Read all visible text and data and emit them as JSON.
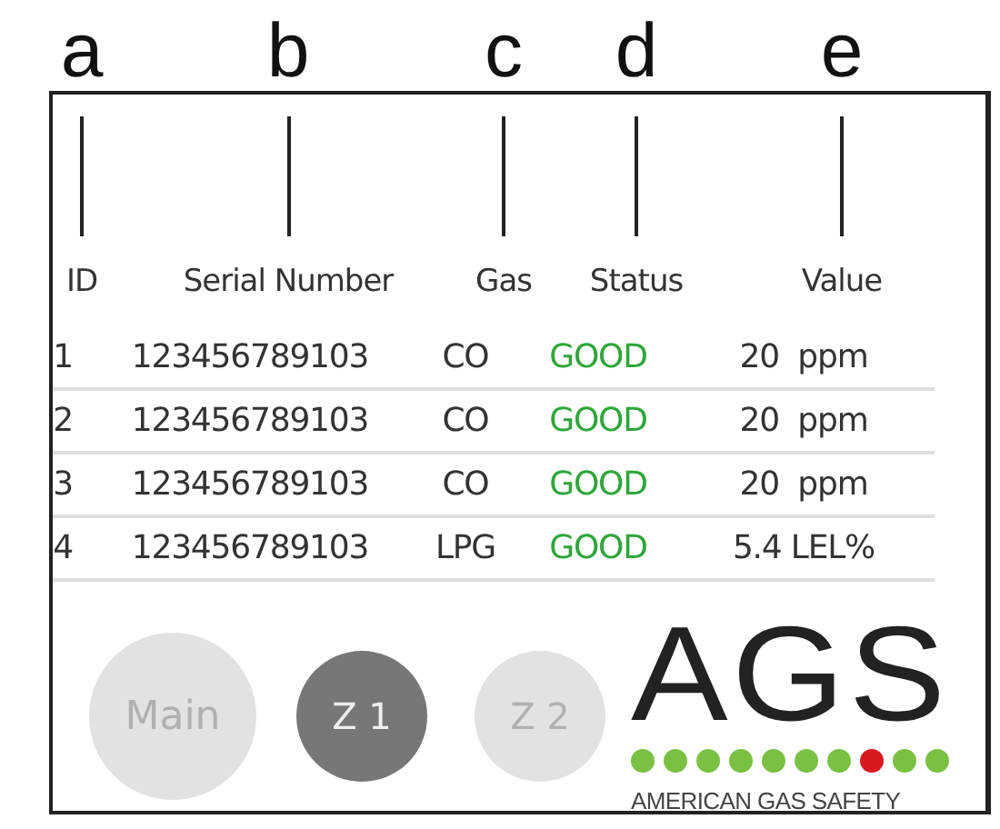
{
  "callouts": [
    "a",
    "b",
    "c",
    "d",
    "e"
  ],
  "columns": [
    "ID",
    "Serial Number",
    "Gas",
    "Status",
    "Value"
  ],
  "rows": [
    {
      "id": "1",
      "serial": "123456789103",
      "gas": "CO",
      "status": "GOOD",
      "value": "20  ppm"
    },
    {
      "id": "2",
      "serial": "123456789103",
      "gas": "CO",
      "status": "GOOD",
      "value": "20  ppm"
    },
    {
      "id": "3",
      "serial": "123456789103",
      "gas": "CO",
      "status": "GOOD",
      "value": "20  ppm"
    },
    {
      "id": "4",
      "serial": "123456789103",
      "gas": "LPG",
      "status": "GOOD",
      "value": "5.4 LEL%"
    }
  ],
  "zone_buttons": [
    {
      "label": "Main",
      "selected": false
    },
    {
      "label": "Z 1",
      "selected": true
    },
    {
      "label": "Z 2",
      "selected": false
    }
  ],
  "logo": {
    "text": "AGS",
    "tagline": "AMERICAN GAS SAFETY",
    "dots": [
      {
        "color": "#7ac143"
      },
      {
        "color": "#7ac143"
      },
      {
        "color": "#7ac143"
      },
      {
        "color": "#7ac143"
      },
      {
        "color": "#7ac143"
      },
      {
        "color": "#7ac143"
      },
      {
        "color": "#7ac143"
      },
      {
        "color": "#d71920"
      },
      {
        "color": "#7ac143"
      },
      {
        "color": "#7ac143"
      }
    ]
  }
}
